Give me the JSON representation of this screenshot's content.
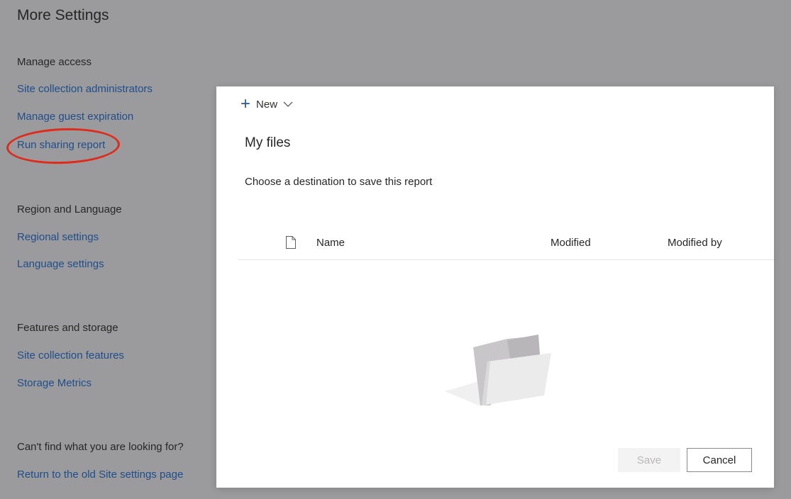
{
  "page": {
    "title": "More Settings"
  },
  "sections": {
    "manage_access": {
      "heading": "Manage access",
      "links": [
        "Site collection administrators",
        "Manage guest expiration",
        "Run sharing report"
      ]
    },
    "region_language": {
      "heading": "Region and Language",
      "links": [
        "Regional settings",
        "Language settings"
      ]
    },
    "features_storage": {
      "heading": "Features and storage",
      "links": [
        "Site collection features",
        "Storage Metrics"
      ]
    },
    "help": {
      "heading": "Can't find what you are looking for?",
      "links": [
        "Return to the old Site settings page"
      ]
    }
  },
  "dialog": {
    "new_label": "New",
    "new_icon": "plus-icon",
    "dropdown_icon": "chevron-down-icon",
    "title": "My files",
    "subtitle": "Choose a destination to save this report",
    "columns": {
      "icon": "file-icon",
      "name": "Name",
      "modified": "Modified",
      "modified_by": "Modified by"
    },
    "empty_state_icon": "empty-folder-icon",
    "buttons": {
      "save": "Save",
      "cancel": "Cancel"
    }
  },
  "colors": {
    "overlay_background": "#9b9a9c",
    "link": "#1f4e8c",
    "highlight_ring": "#e02a1c",
    "accent": "#2b5797"
  }
}
